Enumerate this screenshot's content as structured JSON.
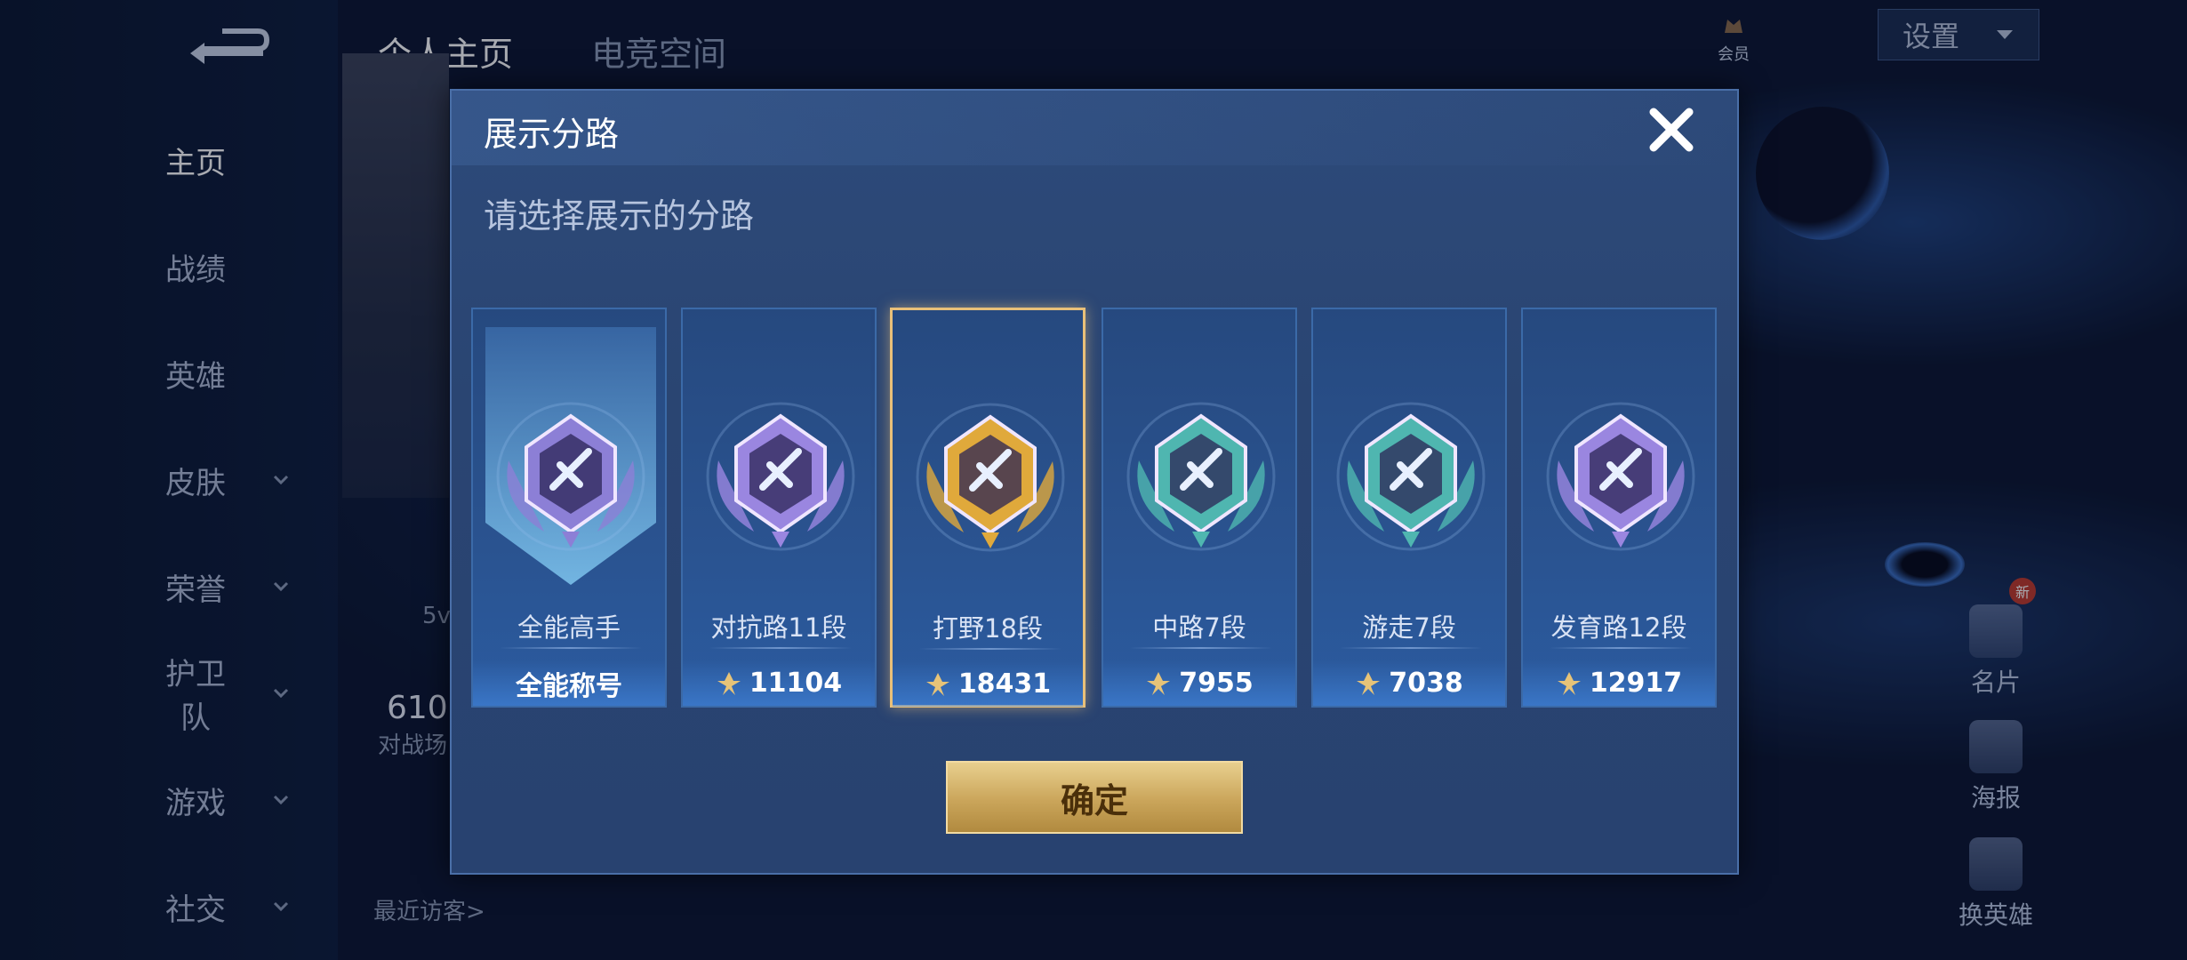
{
  "nav": {
    "items": [
      {
        "label": "主页",
        "active": true,
        "chevron": false
      },
      {
        "label": "战绩",
        "active": false,
        "chevron": false
      },
      {
        "label": "英雄",
        "active": false,
        "chevron": false
      },
      {
        "label": "皮肤",
        "active": false,
        "chevron": true
      },
      {
        "label": "荣誉",
        "active": false,
        "chevron": true
      },
      {
        "label": "护卫队",
        "active": false,
        "chevron": true
      },
      {
        "label": "游戏",
        "active": false,
        "chevron": true
      },
      {
        "label": "社交",
        "active": false,
        "chevron": true
      }
    ]
  },
  "tabs": [
    {
      "label": "个人主页",
      "active": true
    },
    {
      "label": "电竞空间",
      "active": false
    }
  ],
  "background": {
    "stat_value": "610",
    "stat_label": "对战场",
    "mode_text": "5v",
    "recent_visitors_label": "最近访客>"
  },
  "header_right": {
    "vip_label": "会员",
    "settings_label": "设置"
  },
  "side_buttons": [
    {
      "label": "名片",
      "icon": "card-icon"
    },
    {
      "label": "海报",
      "icon": "poster-icon"
    },
    {
      "label": "换英雄",
      "icon": "swap-hero-icon"
    }
  ],
  "new_badge": "新",
  "modal": {
    "title": "展示分路",
    "subtitle": "请选择展示的分路",
    "confirm_label": "确定",
    "cards": [
      {
        "name": "全能高手",
        "footer": "全能称号",
        "has_points": false,
        "selected": false,
        "badge": "all-round-badge",
        "color": "#8c7fd6"
      },
      {
        "name": "对抗路11段",
        "footer": "11104",
        "has_points": true,
        "selected": false,
        "badge": "clash-lane-badge",
        "color": "#9a86e0"
      },
      {
        "name": "打野18段",
        "footer": "18431",
        "has_points": true,
        "selected": true,
        "badge": "jungle-badge",
        "color": "#e0a93b"
      },
      {
        "name": "中路7段",
        "footer": "7955",
        "has_points": true,
        "selected": false,
        "badge": "mid-lane-badge",
        "color": "#4fb6b0"
      },
      {
        "name": "游走7段",
        "footer": "7038",
        "has_points": true,
        "selected": false,
        "badge": "roam-badge",
        "color": "#4fb6b0"
      },
      {
        "name": "发育路12段",
        "footer": "12917",
        "has_points": true,
        "selected": false,
        "badge": "farm-lane-badge",
        "color": "#9a86e0"
      }
    ]
  },
  "colors": {
    "accent_gold": "#e9c079",
    "modal_bg": "#2a4572"
  }
}
